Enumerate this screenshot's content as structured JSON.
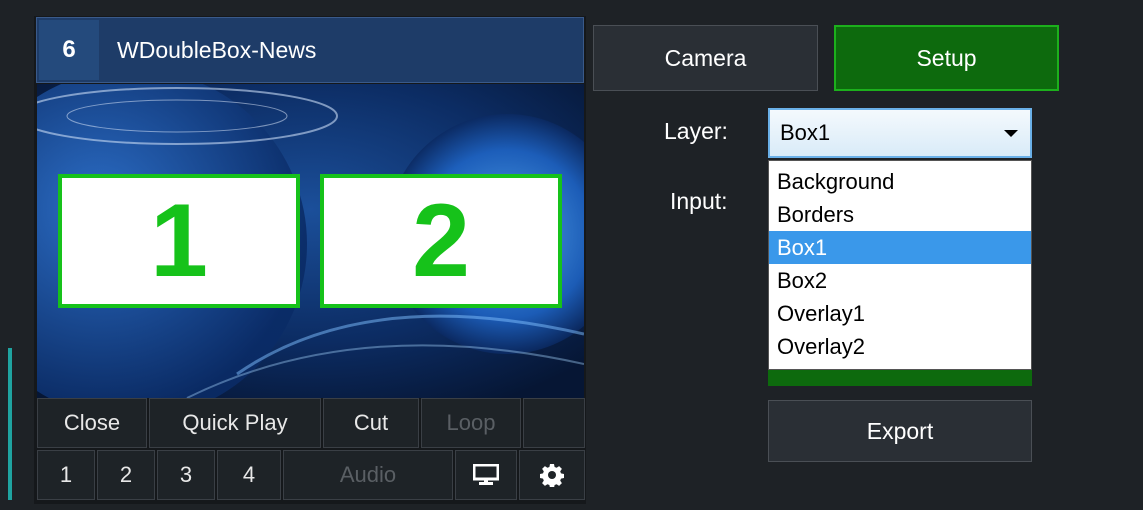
{
  "input_number": "6",
  "input_title": "WDoubleBox-News",
  "preview": {
    "box1_label": "1",
    "box2_label": "2"
  },
  "controls_row1": {
    "close": "Close",
    "quick_play": "Quick Play",
    "cut": "Cut",
    "loop": "Loop"
  },
  "controls_row2": {
    "b1": "1",
    "b2": "2",
    "b3": "3",
    "b4": "4",
    "audio": "Audio",
    "monitor_icon": "monitor-icon",
    "settings_icon": "gear-icon"
  },
  "tabs": {
    "camera": "Camera",
    "setup": "Setup"
  },
  "setup": {
    "layer_label": "Layer:",
    "layer_selected": "Box1",
    "input_label": "Input:",
    "layer_options": [
      "Background",
      "Borders",
      "Box1",
      "Box2",
      "Overlay1",
      "Overlay2"
    ],
    "export": "Export"
  },
  "colors": {
    "accent_green": "#16c21a",
    "setup_green": "#0d6a0d",
    "title_blue": "#1e3c68",
    "selected_blue": "#3a98ea"
  }
}
